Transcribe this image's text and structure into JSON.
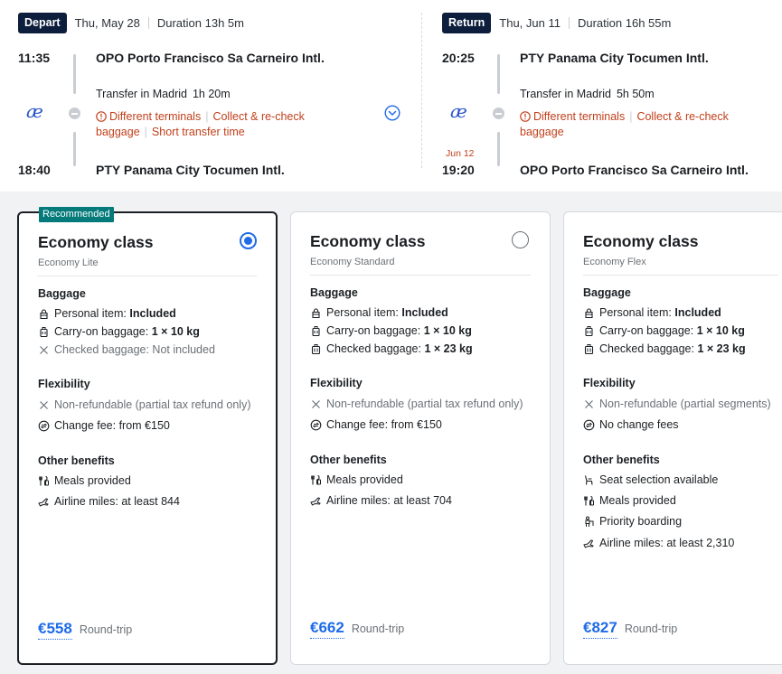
{
  "itinerary": {
    "depart": {
      "badge": "Depart",
      "date": "Thu, May 28",
      "duration": "Duration 13h 5m",
      "dep_time": "11:35",
      "dep_airport": "OPO Porto Francisco Sa Carneiro Intl.",
      "arr_time": "18:40",
      "arr_airport": "PTY Panama City Tocumen Intl.",
      "transfer_city": "Transfer in Madrid",
      "transfer_duration": "1h 20m",
      "warnings": [
        "Different terminals",
        "Collect & re-check baggage",
        "Short transfer time"
      ],
      "airline_logo": "airline-ae-logo"
    },
    "return": {
      "badge": "Return",
      "date": "Thu, Jun 11",
      "duration": "Duration 16h 55m",
      "dep_time": "20:25",
      "dep_airport": "PTY Panama City Tocumen Intl.",
      "arr_date_note": "Jun 12",
      "arr_time": "19:20",
      "arr_airport": "OPO Porto Francisco Sa Carneiro Intl.",
      "transfer_city": "Transfer in Madrid",
      "transfer_duration": "5h 50m",
      "warnings": [
        "Different terminals",
        "Collect & re-check baggage"
      ],
      "airline_logo": "airline-ae-logo"
    }
  },
  "sections": {
    "baggage": "Baggage",
    "flexibility": "Flexibility",
    "other": "Other benefits"
  },
  "fares": [
    {
      "tag": "Recommended",
      "title": "Economy class",
      "subtitle": "Economy Lite",
      "selected": true,
      "baggage": [
        {
          "label": "Personal item: ",
          "value": "Included",
          "icon": "bag-icon"
        },
        {
          "label": "Carry-on baggage: ",
          "value": "1 × 10 kg",
          "icon": "carry-on-icon"
        },
        {
          "label": "Checked baggage: Not included",
          "value": "",
          "icon": "x-icon"
        }
      ],
      "flexibility": [
        {
          "label": "Non-refundable (partial tax refund only)",
          "icon": "x-icon"
        },
        {
          "label": "Change fee: from €150",
          "icon": "change-icon"
        }
      ],
      "other": [
        {
          "label": "Meals provided",
          "icon": "meal-icon"
        },
        {
          "label": "Airline miles: at least 844",
          "icon": "miles-icon"
        }
      ],
      "price": "€558",
      "price_note": "Round-trip"
    },
    {
      "title": "Economy class",
      "subtitle": "Economy Standard",
      "selected": false,
      "baggage": [
        {
          "label": "Personal item: ",
          "value": "Included",
          "icon": "bag-icon"
        },
        {
          "label": "Carry-on baggage: ",
          "value": "1 × 10 kg",
          "icon": "carry-on-icon"
        },
        {
          "label": "Checked baggage: ",
          "value": "1 × 23 kg",
          "icon": "suitcase-icon"
        }
      ],
      "flexibility": [
        {
          "label": "Non-refundable (partial tax refund only)",
          "icon": "x-icon"
        },
        {
          "label": "Change fee: from €150",
          "icon": "change-icon"
        }
      ],
      "other": [
        {
          "label": "Meals provided",
          "icon": "meal-icon"
        },
        {
          "label": "Airline miles: at least 704",
          "icon": "miles-icon"
        }
      ],
      "price": "€662",
      "price_note": "Round-trip"
    },
    {
      "title": "Economy class",
      "subtitle": "Economy Flex",
      "selected": false,
      "baggage": [
        {
          "label": "Personal item: ",
          "value": "Included",
          "icon": "bag-icon"
        },
        {
          "label": "Carry-on baggage: ",
          "value": "1 × 10 kg",
          "icon": "carry-on-icon"
        },
        {
          "label": "Checked baggage: ",
          "value": "1 × 23 kg",
          "icon": "suitcase-icon"
        }
      ],
      "flexibility": [
        {
          "label": "Non-refundable (partial segments)",
          "icon": "x-icon"
        },
        {
          "label": "No change fees",
          "icon": "change-icon"
        }
      ],
      "other": [
        {
          "label": "Seat selection available",
          "icon": "seat-icon"
        },
        {
          "label": "Meals provided",
          "icon": "meal-icon"
        },
        {
          "label": "Priority boarding",
          "icon": "priority-icon"
        },
        {
          "label": "Airline miles: at least 2,310",
          "icon": "miles-icon"
        }
      ],
      "price": "€827",
      "price_note": "Round-trip"
    }
  ],
  "colors": {
    "badge_bg": "#0c1e3c",
    "warning": "#c0401b",
    "price": "#1f6be8",
    "recommended": "#047a7a",
    "background": "#f0f2f4"
  }
}
